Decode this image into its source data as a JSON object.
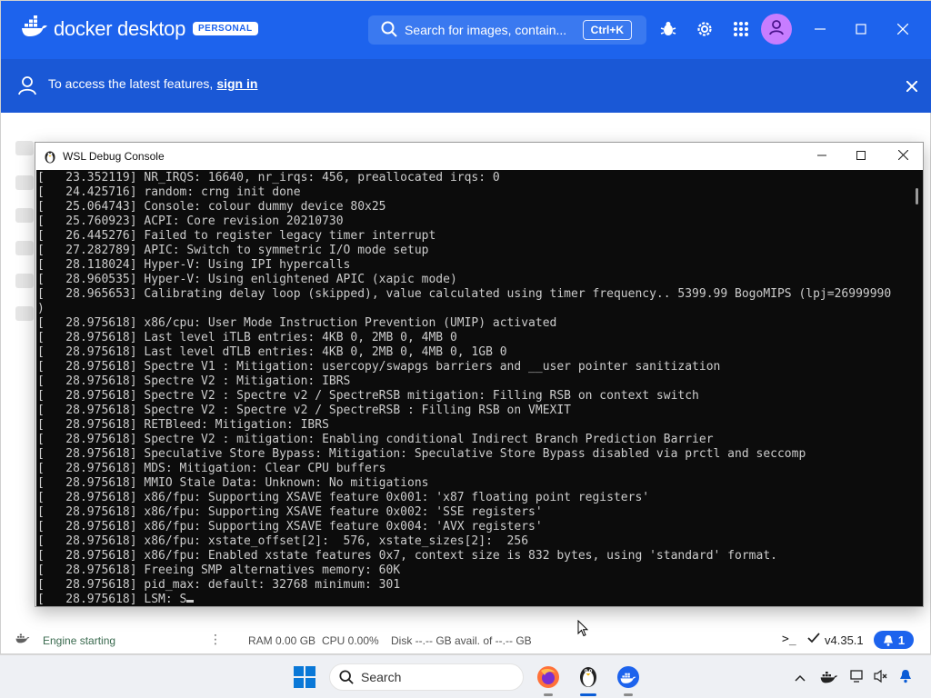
{
  "docker": {
    "app_name": "docker desktop",
    "plan_badge": "PERSONAL",
    "search_placeholder": "Search for images, contain...",
    "search_shortcut": "Ctrl+K",
    "banner_text": "To access the latest features,",
    "banner_link": "sign in"
  },
  "status_bar": {
    "engine": "Engine starting",
    "ram": "RAM 0.00 GB",
    "cpu": "CPU 0.00%",
    "disk": "Disk --.-- GB avail. of --.-- GB",
    "version": "v4.35.1",
    "notifications": "1"
  },
  "wsl_console": {
    "title": "WSL Debug Console",
    "lines": [
      "[   23.352119] NR_IRQS: 16640, nr_irqs: 456, preallocated irqs: 0",
      "[   24.425716] random: crng init done",
      "[   25.064743] Console: colour dummy device 80x25",
      "[   25.760923] ACPI: Core revision 20210730",
      "[   26.445276] Failed to register legacy timer interrupt",
      "[   27.282789] APIC: Switch to symmetric I/O mode setup",
      "[   28.118024] Hyper-V: Using IPI hypercalls",
      "[   28.960535] Hyper-V: Using enlightened APIC (xapic mode)",
      "[   28.965653] Calibrating delay loop (skipped), value calculated using timer frequency.. 5399.99 BogoMIPS (lpj=26999990",
      ")",
      "[   28.975618] x86/cpu: User Mode Instruction Prevention (UMIP) activated",
      "[   28.975618] Last level iTLB entries: 4KB 0, 2MB 0, 4MB 0",
      "[   28.975618] Last level dTLB entries: 4KB 0, 2MB 0, 4MB 0, 1GB 0",
      "[   28.975618] Spectre V1 : Mitigation: usercopy/swapgs barriers and __user pointer sanitization",
      "[   28.975618] Spectre V2 : Mitigation: IBRS",
      "[   28.975618] Spectre V2 : Spectre v2 / SpectreRSB mitigation: Filling RSB on context switch",
      "[   28.975618] Spectre V2 : Spectre v2 / SpectreRSB : Filling RSB on VMEXIT",
      "[   28.975618] RETBleed: Mitigation: IBRS",
      "[   28.975618] Spectre V2 : mitigation: Enabling conditional Indirect Branch Prediction Barrier",
      "[   28.975618] Speculative Store Bypass: Mitigation: Speculative Store Bypass disabled via prctl and seccomp",
      "[   28.975618] MDS: Mitigation: Clear CPU buffers",
      "[   28.975618] MMIO Stale Data: Unknown: No mitigations",
      "[   28.975618] x86/fpu: Supporting XSAVE feature 0x001: 'x87 floating point registers'",
      "[   28.975618] x86/fpu: Supporting XSAVE feature 0x002: 'SSE registers'",
      "[   28.975618] x86/fpu: Supporting XSAVE feature 0x004: 'AVX registers'",
      "[   28.975618] x86/fpu: xstate_offset[2]:  576, xstate_sizes[2]:  256",
      "[   28.975618] x86/fpu: Enabled xstate features 0x7, context size is 832 bytes, using 'standard' format.",
      "[   28.975618] Freeing SMP alternatives memory: 60K",
      "[   28.975618] pid_max: default: 32768 minimum: 301",
      "[   28.975618] LSM: S"
    ]
  },
  "taskbar": {
    "search_label": "Search"
  },
  "colors": {
    "docker_blue": "#1d63ed",
    "banner_blue": "#1a58d6",
    "terminal_bg": "#0c0c0c",
    "terminal_fg": "#cccccc"
  },
  "icons": [
    "docker-whale-icon",
    "search-icon",
    "bug-icon",
    "gear-icon",
    "grid-icon",
    "user-icon",
    "penguin-icon",
    "terminal-icon",
    "check-icon",
    "bell-icon",
    "windows-start-icon",
    "firefox-icon",
    "wifi-icon",
    "volume-icon",
    "chevron-up-icon"
  ]
}
